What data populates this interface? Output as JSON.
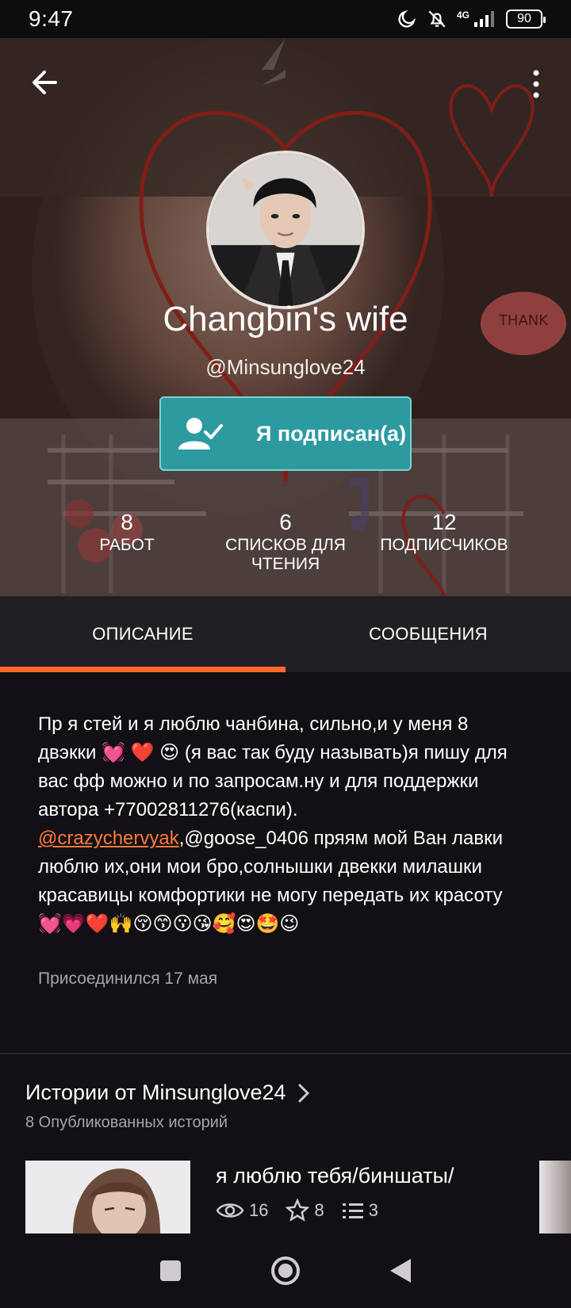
{
  "status_bar": {
    "time": "9:47",
    "network": "4G",
    "battery": "90",
    "icons": [
      "moon-icon",
      "bell-off-icon",
      "signal-icon",
      "battery-icon"
    ]
  },
  "profile": {
    "display_name": "Changbin's wife",
    "username": "@Minsunglove24",
    "follow_button": "Я подписан(а)",
    "cover_sticker": "THANK"
  },
  "stats": [
    {
      "value": "8",
      "label": "РАБОТ"
    },
    {
      "value": "6",
      "label": "СПИСКОВ ДЛЯ ЧТЕНИЯ"
    },
    {
      "value": "12",
      "label": "ПОДПИСЧИКОВ"
    }
  ],
  "tabs": [
    {
      "label": "ОПИСАНИЕ",
      "active": true
    },
    {
      "label": "СООБЩЕНИЯ",
      "active": false
    }
  ],
  "description": {
    "part1": "Пр я стей и я люблю чанбина, сильно,и у меня 8 двэкки 💓 ❤️ 😍 (я вас так буду называть)я пишу для вас фф можно и по запросам.ну и для поддержки автора +77002811276(каспи).",
    "mention": "@crazychervyak",
    "part2": ",@goose_0406 пряям мой Ван лавки люблю их,они мои бро,солнышки двекки милашки красавицы комфортики не могу передать их красоту💓💗❤️🙌😚😙😗😘🥰😍🤩😉",
    "joined": "Присоединился 17 мая"
  },
  "stories": {
    "title": "Истории от Minsunglove24",
    "subtitle": "8 Опубликованных историй",
    "items": [
      {
        "title": "я люблю тебя/биншаты/",
        "reads": "16",
        "votes": "8",
        "parts": "3"
      }
    ]
  },
  "colors": {
    "accent_orange": "#ff6a2c",
    "follow_teal": "#2d9aa0",
    "background": "#121014",
    "tab_bar": "#221f24"
  }
}
